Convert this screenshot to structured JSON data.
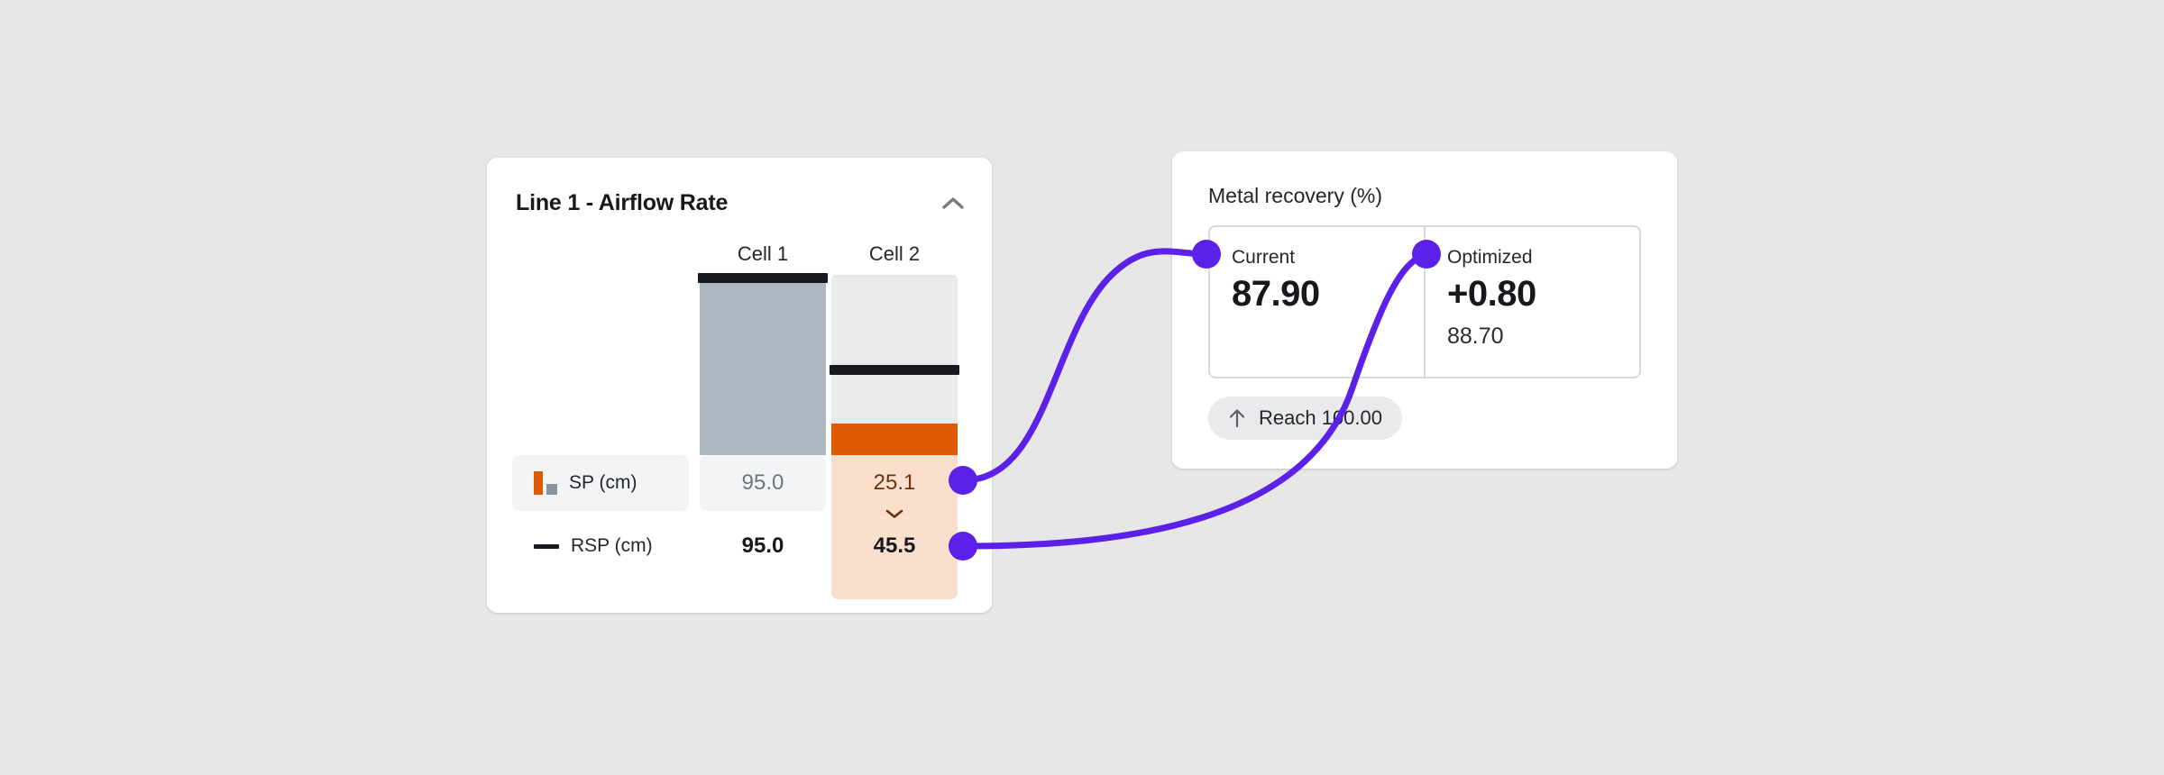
{
  "theme": {
    "page_bg": "#E7E7E7",
    "card_bg": "#FFFFFF",
    "accent_purple": "#5B21E8",
    "accent_orange": "#DD5A02",
    "peach": "#FADFCD",
    "grey_bar": "#AEB6C0",
    "track_grey": "#E9EAEC",
    "rsp_black": "#17191E",
    "orange_text": "#6E3209",
    "grey_text": "#70767F"
  },
  "left_panel": {
    "title": "Line 1 - Airflow Rate",
    "collapse_icon": "chevron-up-icon",
    "columns": [
      {
        "header": "Cell 1"
      },
      {
        "header": "Cell 2"
      }
    ],
    "legend": [
      {
        "icon": "sp-bars-icon",
        "label": "SP (cm)"
      },
      {
        "icon": "rsp-line-icon",
        "label": "RSP (cm)"
      }
    ],
    "rows": [
      {
        "name": "SP (cm)",
        "values": [
          "95.0",
          "25.1"
        ]
      },
      {
        "name": "RSP (cm)",
        "values": [
          "95.0",
          "45.5"
        ]
      }
    ],
    "change_icon": "chevron-down-icon"
  },
  "right_panel": {
    "title": "Metal recovery (%)",
    "metrics": [
      {
        "label": "Current",
        "value": "87.90",
        "sub": ""
      },
      {
        "label": "Optimized",
        "value": "+0.80",
        "sub": "88.70"
      }
    ],
    "goal": {
      "icon": "arrow-up-icon",
      "label": "Reach 100.00"
    }
  },
  "chart_data": {
    "type": "bar",
    "title": "Line 1 - Airflow Rate",
    "categories": [
      "Cell 1",
      "Cell 2"
    ],
    "series": [
      {
        "name": "SP (cm)",
        "values": [
          95.0,
          25.1
        ]
      },
      {
        "name": "RSP (cm)",
        "values": [
          95.0,
          45.5
        ]
      }
    ],
    "ylabel": "cm",
    "xlabel": "",
    "grid": false,
    "legend_position": "left",
    "notes": "Cell 1 SP shown as grey filled bar reaching the RSP marker at 95.0; Cell 2 SP shown as orange band at 25.1 well below its RSP marker at 45.5."
  }
}
